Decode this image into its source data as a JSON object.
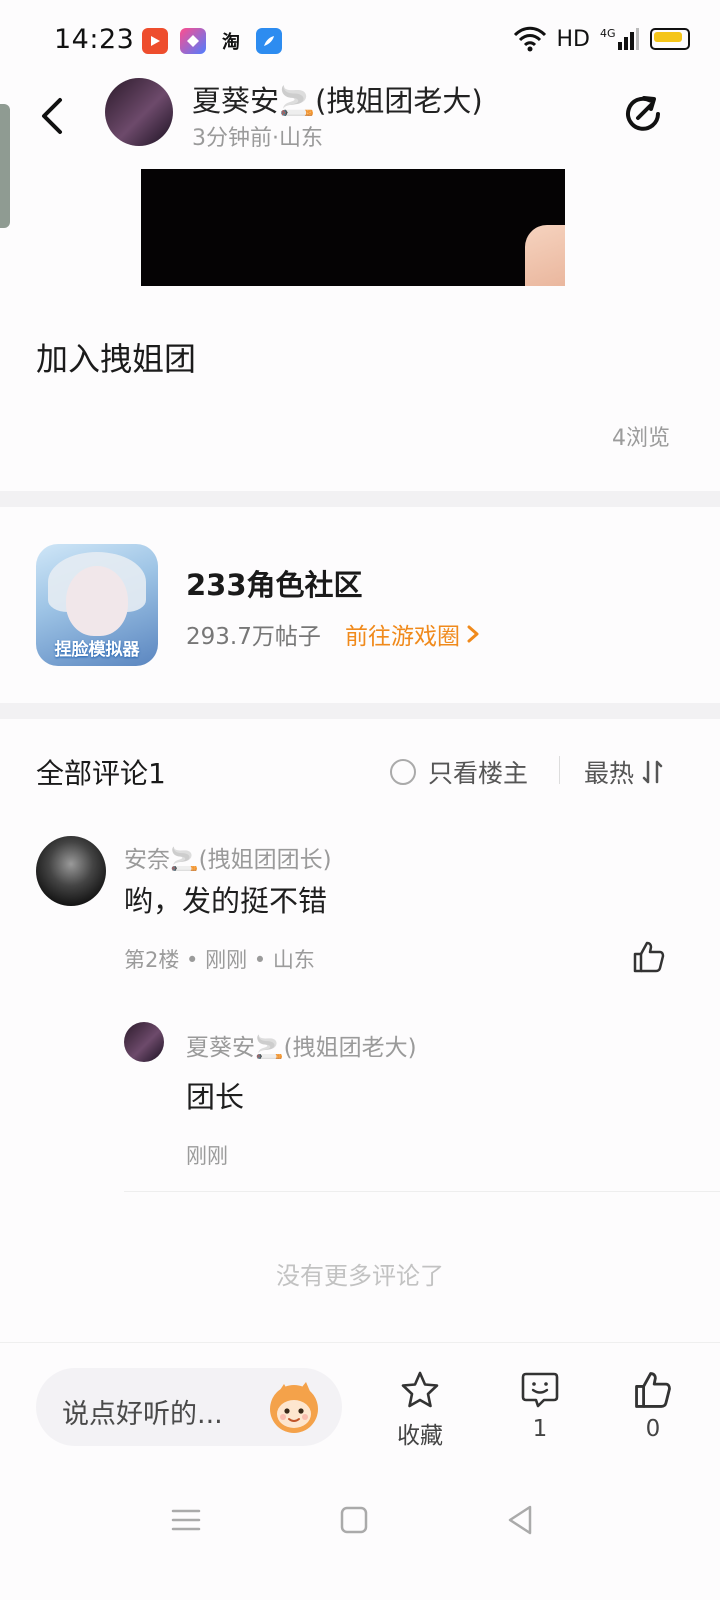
{
  "status_bar": {
    "time": "14:23",
    "app_icons": [
      "video-app-icon",
      "shortcut-app-icon",
      "taobao-app-icon",
      "browser-app-icon"
    ],
    "taobao_label": "淘",
    "network": "HD",
    "signal": "4G"
  },
  "header": {
    "author_name": "夏葵安🚬(拽姐团老大)",
    "author_meta": "3分钟前·山东",
    "back_icon": "chevron-left-icon",
    "share_icon": "share-icon"
  },
  "post": {
    "text": "加入拽姐团",
    "views": "4浏览"
  },
  "game_card": {
    "title": "233角色社区",
    "posts": "293.7万帖子",
    "link": "前往游戏圈",
    "icon_caption": "捏脸模拟器"
  },
  "comments": {
    "title": "全部评论1",
    "owner_only": "只看楼主",
    "sort": "最热",
    "items": [
      {
        "name": "安奈🚬(拽姐团团长)",
        "body": "哟，发的挺不错",
        "meta": "第2楼 • 刚刚 • 山东",
        "replies": [
          {
            "name": "夏葵安🚬(拽姐团老大)",
            "body": "团长",
            "meta": "刚刚"
          }
        ]
      }
    ],
    "no_more": "没有更多评论了"
  },
  "bottom_bar": {
    "input_placeholder": "说点好听的...",
    "favorite_label": "收藏",
    "comment_count": "1",
    "like_count": "0"
  },
  "colors": {
    "accent": "#f08a1c",
    "text": "#1f1f1f",
    "muted": "#9a9a9a"
  }
}
